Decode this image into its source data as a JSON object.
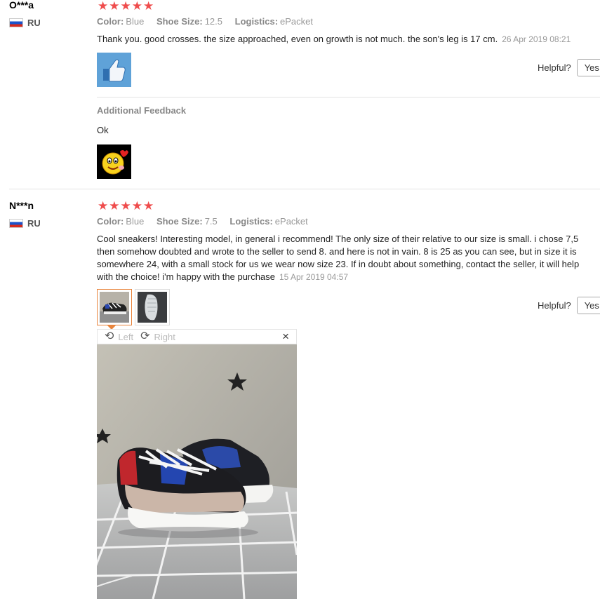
{
  "reviews": [
    {
      "user": "O***a",
      "country": "RU",
      "stars": "★★★★★",
      "color_label": "Color:",
      "color_value": "Blue",
      "size_label": "Shoe Size:",
      "size_value": "12.5",
      "logistics_label": "Logistics:",
      "logistics_value": "ePacket",
      "text": "Thank you. good crosses. the size approached, even on growth is not much. the son's leg is 17 cm.",
      "date": "26 Apr 2019 08:21",
      "helpful_label": "Helpful?",
      "yes_label": "Yes",
      "additional_feedback_title": "Additional Feedback",
      "additional_feedback_text": "Ok"
    },
    {
      "user": "N***n",
      "country": "RU",
      "stars": "★★★★★",
      "color_label": "Color:",
      "color_value": "Blue",
      "size_label": "Shoe Size:",
      "size_value": "7.5",
      "logistics_label": "Logistics:",
      "logistics_value": "ePacket",
      "text": "Cool sneakers! Interesting model, in general i recommend! The only size of their relative to our size is small. i chose 7,5 then somehow doubted and wrote to the seller to send 8. and here is not in vain. 8 is 25 as you can see, but in size it is somewhere 24, with a small stock for us we wear now size 23. If in doubt about something, contact the seller, it will help with the choice! i'm happy with the purchase",
      "date": "15 Apr 2019 04:57",
      "helpful_label": "Helpful?",
      "yes_label": "Yes",
      "viewer": {
        "left_label": "Left",
        "right_label": "Right",
        "close_glyph": "×"
      }
    }
  ],
  "colors": {
    "star": "#ef4c4c",
    "thumb_active_border": "#e8843c"
  }
}
